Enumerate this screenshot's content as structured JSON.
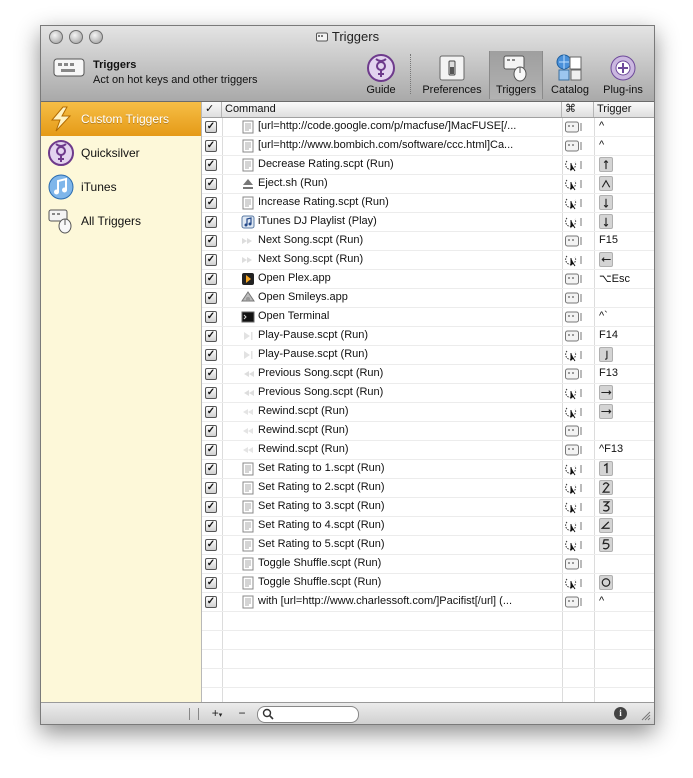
{
  "window": {
    "title": "Triggers"
  },
  "header": {
    "title": "Triggers",
    "subtitle": "Act on hot keys and other triggers"
  },
  "toolbar": {
    "guide": "Guide",
    "preferences": "Preferences",
    "triggers": "Triggers",
    "catalog": "Catalog",
    "plugins": "Plug-ins"
  },
  "sidebar": {
    "items": [
      {
        "label": "Custom Triggers"
      },
      {
        "label": "Quicksilver"
      },
      {
        "label": "iTunes"
      },
      {
        "label": "All Triggers"
      }
    ]
  },
  "table": {
    "headers": {
      "check": "✓",
      "command": "Command",
      "cmd": "⌘",
      "trigger": "Trigger"
    },
    "rows": [
      {
        "checked": true,
        "icon": "script-doc-icon",
        "command": "[url=http://code.google.com/p/macfuse/]MacFUSE[/...",
        "type": "hotkey",
        "trigger": "^"
      },
      {
        "checked": true,
        "icon": "script-doc-icon",
        "command": "[url=http://www.bombich.com/software/ccc.html]Ca...",
        "type": "hotkey",
        "trigger": "^"
      },
      {
        "checked": true,
        "icon": "script-doc-icon",
        "command": "Decrease Rating.scpt (Run)",
        "type": "mouse",
        "trigger": "gesture-up-icon"
      },
      {
        "checked": true,
        "icon": "eject-icon",
        "command": "Eject.sh (Run)",
        "type": "mouse",
        "trigger": "gesture-caret-icon"
      },
      {
        "checked": true,
        "icon": "script-doc-icon",
        "command": "Increase Rating.scpt (Run)",
        "type": "mouse",
        "trigger": "gesture-down-icon"
      },
      {
        "checked": true,
        "icon": "itunes-note-icon",
        "command": "iTunes DJ Playlist (Play)",
        "type": "mouse",
        "trigger": "gesture-down-icon"
      },
      {
        "checked": true,
        "icon": "next-track-icon",
        "command": "Next Song.scpt (Run)",
        "type": "hotkey",
        "trigger": "F15"
      },
      {
        "checked": true,
        "icon": "next-track-icon",
        "command": "Next Song.scpt (Run)",
        "type": "mouse",
        "trigger": "gesture-left-icon"
      },
      {
        "checked": true,
        "icon": "plex-app-icon",
        "command": "Open Plex.app",
        "type": "hotkey",
        "trigger": "⌥Esc"
      },
      {
        "checked": true,
        "icon": "smileys-app-icon",
        "command": "Open Smileys.app",
        "type": "hotkey",
        "trigger": ""
      },
      {
        "checked": true,
        "icon": "terminal-app-icon",
        "command": "Open Terminal",
        "type": "hotkey",
        "trigger": "^`"
      },
      {
        "checked": true,
        "icon": "play-pause-icon",
        "command": "Play-Pause.scpt (Run)",
        "type": "hotkey",
        "trigger": "F14"
      },
      {
        "checked": true,
        "icon": "play-pause-icon",
        "command": "Play-Pause.scpt (Run)",
        "type": "mouse",
        "trigger": "gesture-hook-icon"
      },
      {
        "checked": true,
        "icon": "previous-track-icon",
        "command": "Previous Song.scpt (Run)",
        "type": "hotkey",
        "trigger": "F13"
      },
      {
        "checked": true,
        "icon": "previous-track-icon",
        "command": "Previous Song.scpt (Run)",
        "type": "mouse",
        "trigger": "gesture-right-icon"
      },
      {
        "checked": true,
        "icon": "rewind-icon",
        "command": "Rewind.scpt (Run)",
        "type": "mouse",
        "trigger": "gesture-right-icon"
      },
      {
        "checked": true,
        "icon": "rewind-icon",
        "command": "Rewind.scpt (Run)",
        "type": "hotkey",
        "trigger": ""
      },
      {
        "checked": true,
        "icon": "rewind-icon",
        "command": "Rewind.scpt (Run)",
        "type": "hotkey",
        "trigger": "^F13"
      },
      {
        "checked": true,
        "icon": "script-doc-icon",
        "command": "Set Rating to 1.scpt (Run)",
        "type": "mouse",
        "trigger": "gesture-1-icon"
      },
      {
        "checked": true,
        "icon": "script-doc-icon",
        "command": "Set Rating to 2.scpt (Run)",
        "type": "mouse",
        "trigger": "gesture-2-icon"
      },
      {
        "checked": true,
        "icon": "script-doc-icon",
        "command": "Set Rating to 3.scpt (Run)",
        "type": "mouse",
        "trigger": "gesture-3-icon"
      },
      {
        "checked": true,
        "icon": "script-doc-icon",
        "command": "Set Rating to 4.scpt (Run)",
        "type": "mouse",
        "trigger": "gesture-4-icon"
      },
      {
        "checked": true,
        "icon": "script-doc-icon",
        "command": "Set Rating to 5.scpt (Run)",
        "type": "mouse",
        "trigger": "gesture-5-icon"
      },
      {
        "checked": true,
        "icon": "script-doc-icon",
        "command": "Toggle Shuffle.scpt (Run)",
        "type": "hotkey",
        "trigger": ""
      },
      {
        "checked": true,
        "icon": "script-doc-icon",
        "command": "Toggle Shuffle.scpt (Run)",
        "type": "mouse",
        "trigger": "gesture-circle-icon"
      },
      {
        "checked": true,
        "icon": "script-doc-icon",
        "command": "with [url=http://www.charlessoft.com/]Pacifist[/url] (...",
        "type": "hotkey",
        "trigger": "^"
      }
    ]
  },
  "bottombar": {
    "add": "+",
    "remove": "−",
    "search_placeholder": "",
    "info": "i"
  }
}
